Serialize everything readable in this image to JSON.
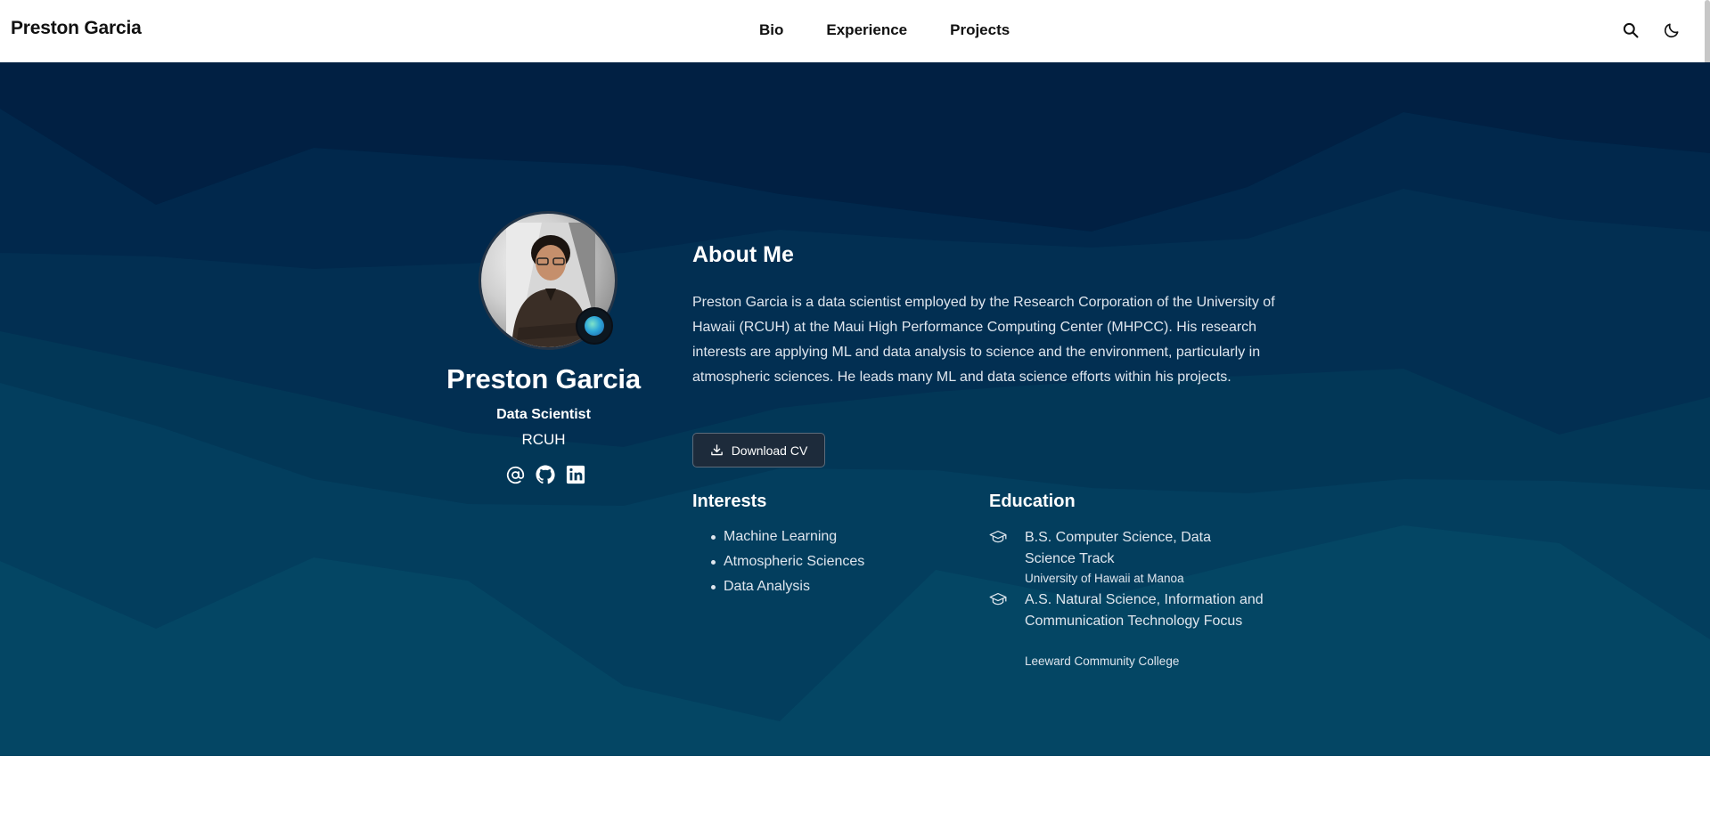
{
  "navbar": {
    "brand": "Preston Garcia",
    "links": [
      "Bio",
      "Experience",
      "Projects"
    ],
    "search_icon": "search-icon",
    "theme_icon": "moon-icon"
  },
  "profile": {
    "name": "Preston Garcia",
    "role": "Data Scientist",
    "organization": "RCUH",
    "avatar_badge_icon": "globe-icon",
    "socials": [
      "at-sign-icon",
      "github-icon",
      "linkedin-icon"
    ]
  },
  "about": {
    "title": "About Me",
    "text": "Preston Garcia is a data scientist employed by the Research Corporation of the University of Hawaii (RCUH) at the Maui High Performance Computing Center (MHPCC). His research interests are applying ML and data analysis to science and the environment, particularly in atmospheric sciences. He leads many ML and data science efforts within his projects.",
    "cv_button": "Download CV"
  },
  "interests": {
    "title": "Interests",
    "items": [
      "Machine Learning",
      "Atmospheric Sciences",
      "Data Analysis"
    ]
  },
  "education": {
    "title": "Education",
    "items": [
      {
        "degree": "B.S. Computer Science, Data Science Track",
        "school": "University of Hawaii at Manoa"
      },
      {
        "degree": "A.S. Natural Science, Information and Communication Technology Focus",
        "school": "Leeward Community College"
      }
    ]
  },
  "colors": {
    "hero_dark": "#012043",
    "hero_mid": "#023a5a",
    "hero_light": "#044e6e",
    "text_light": "#dfe6ee"
  }
}
